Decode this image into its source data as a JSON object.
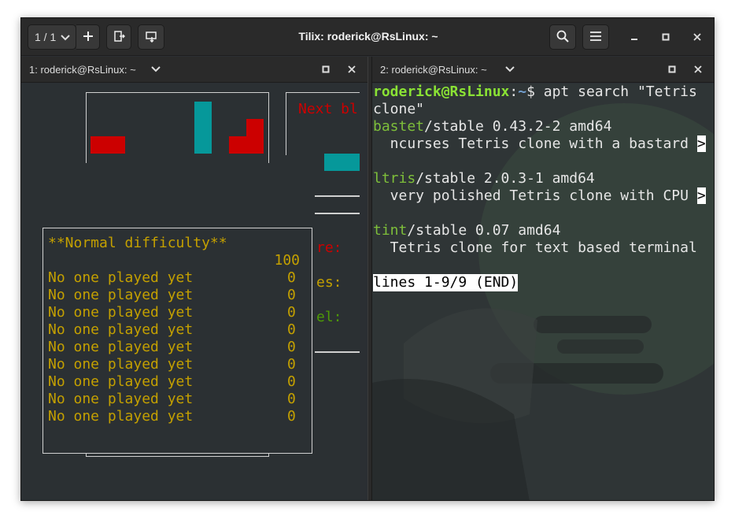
{
  "window": {
    "title": "Tilix: roderick@RsLinux: ~",
    "session_label": "1 / 1"
  },
  "icons": {
    "dropdown": "chevron-down-icon",
    "add": "plus-icon",
    "split_right": "split-horizontal-icon",
    "split_down": "split-vertical-icon",
    "search": "search-icon",
    "menu": "hamburger-menu-icon",
    "minimize": "minimize-icon",
    "maximize": "maximize-icon",
    "close": "close-icon"
  },
  "colors": {
    "tetris_red": "#cc0000",
    "tetris_cyan": "#06989a",
    "tetris_blue": "#3465a4",
    "tetris_yellow": "#c4a000",
    "tetris_purple": "#75507b",
    "prompt_green": "#8ae234"
  },
  "left_pane": {
    "title": "1: roderick@RsLinux: ~",
    "next_block_label": "Next bl",
    "side_labels": [
      "re:",
      "es:",
      "el:"
    ],
    "scores": {
      "header": "**Normal difficulty**",
      "top_value": "100",
      "rows": [
        {
          "name": "No one played yet",
          "score": "0"
        },
        {
          "name": "No one played yet",
          "score": "0"
        },
        {
          "name": "No one played yet",
          "score": "0"
        },
        {
          "name": "No one played yet",
          "score": "0"
        },
        {
          "name": "No one played yet",
          "score": "0"
        },
        {
          "name": "No one played yet",
          "score": "0"
        },
        {
          "name": "No one played yet",
          "score": "0"
        },
        {
          "name": "No one played yet",
          "score": "0"
        },
        {
          "name": "No one played yet",
          "score": "0"
        }
      ]
    }
  },
  "right_pane": {
    "title": "2: roderick@RsLinux: ~",
    "prompt_user": "roderick@RsLinux",
    "prompt_sep": ":",
    "prompt_path": "~",
    "prompt_symbol": "$",
    "command_line1": " apt search \"Tetris",
    "command_line2": "clone\"",
    "results": [
      {
        "pkg": "bastet",
        "meta": "/stable 0.43.2-2 amd64",
        "desc": "  ncurses Tetris clone with a bastard ",
        "more": ">"
      },
      {
        "pkg": "ltris",
        "meta": "/stable 2.0.3-1 amd64",
        "desc": "  very polished Tetris clone with CPU ",
        "more": ">"
      },
      {
        "pkg": "tint",
        "meta": "/stable 0.07 amd64",
        "desc": "  Tetris clone for text based terminal",
        "more": ""
      }
    ],
    "pager_status": "lines 1-9/9 (END)"
  }
}
